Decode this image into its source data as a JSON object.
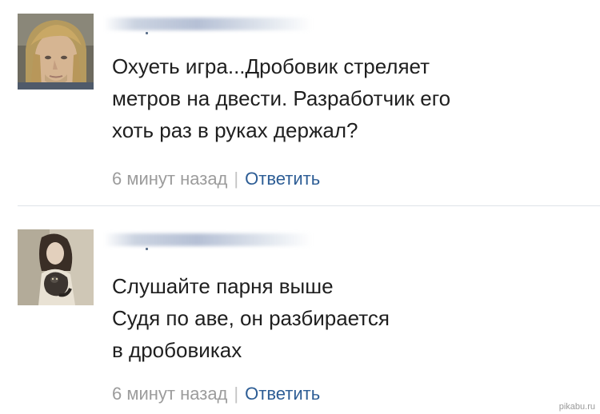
{
  "comments": [
    {
      "lines": [
        "Охуеть игра...Дробовик стреляет",
        "метров на двести. Разработчик его",
        "хоть раз в руках держал?"
      ],
      "time": "6 минут назад",
      "separator": "|",
      "reply": "Ответить"
    },
    {
      "lines": [
        "Слушайте парня выше",
        "Судя по аве, он разбирается",
        "в дробовиках"
      ],
      "time": "6 минут назад",
      "separator": "|",
      "reply": "Ответить"
    }
  ],
  "watermark": "pikabu.ru",
  "colors": {
    "text": "#1f1f1f",
    "meta": "#9c9c9c",
    "link": "#2d5d95",
    "divider": "#dfe3e8"
  }
}
